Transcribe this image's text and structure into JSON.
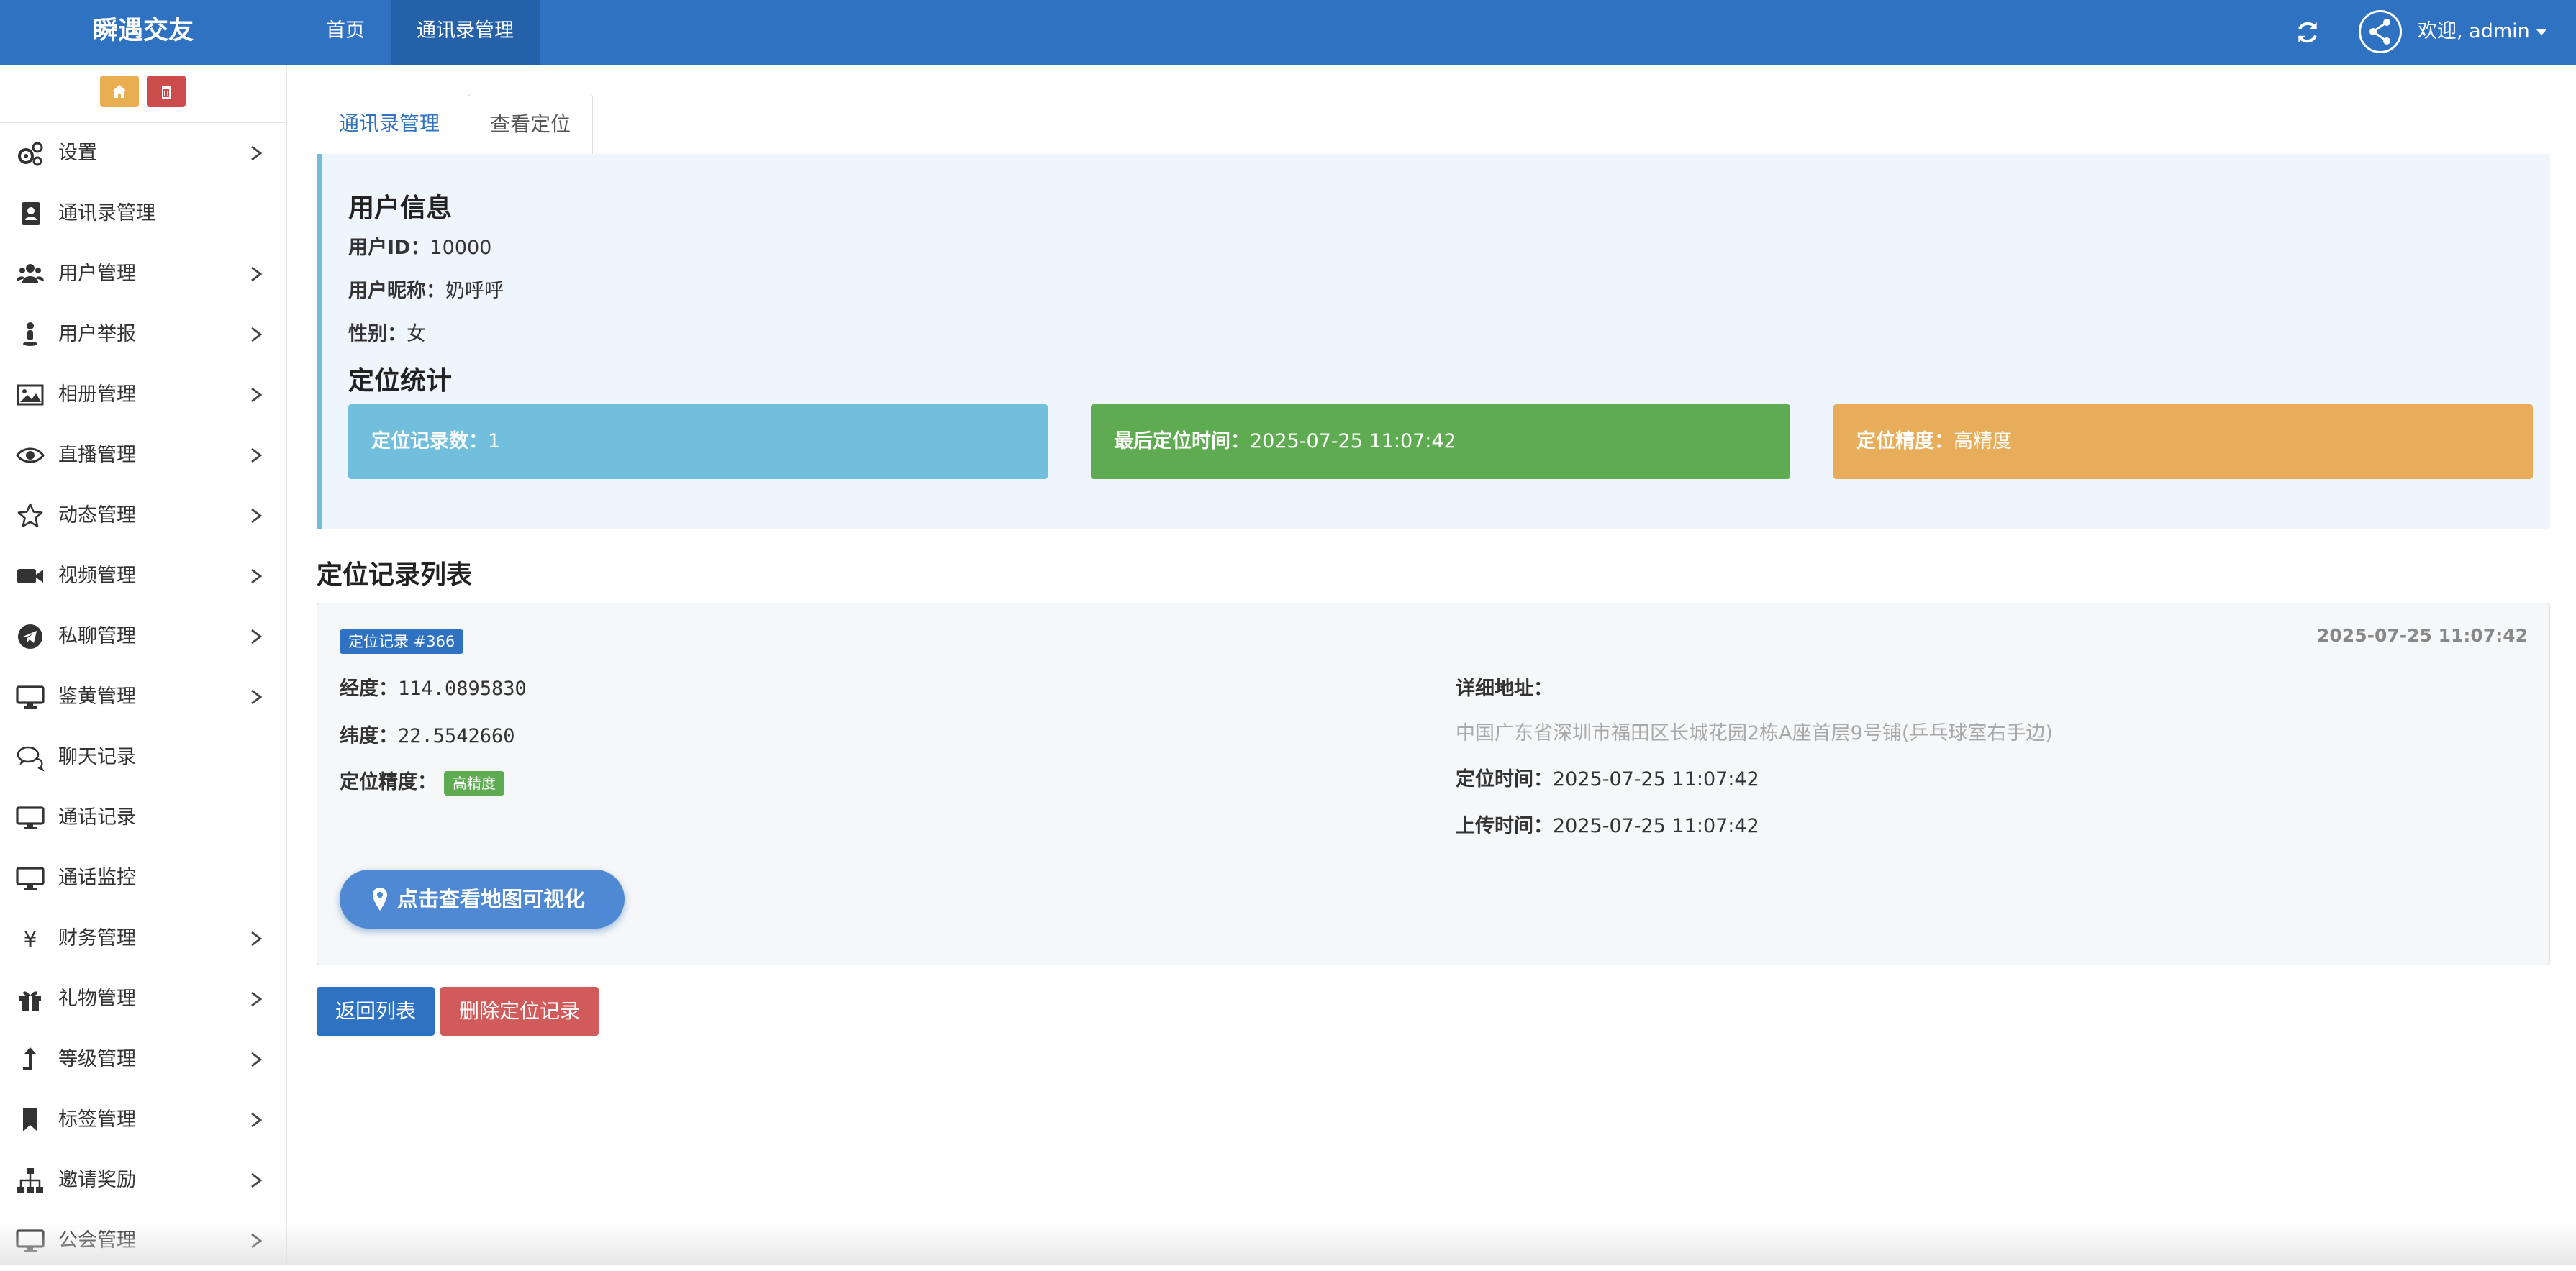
{
  "app": {
    "brand": "瞬遇交友",
    "nav": [
      "首页",
      "通讯录管理"
    ],
    "user_greeting": "欢迎, admin"
  },
  "sidebar": {
    "items": [
      {
        "label": "设置",
        "icon": "gears-icon",
        "expandable": true
      },
      {
        "label": "通讯录管理",
        "icon": "address-book-icon",
        "expandable": false
      },
      {
        "label": "用户管理",
        "icon": "users-icon",
        "expandable": true
      },
      {
        "label": "用户举报",
        "icon": "report-user-icon",
        "expandable": true
      },
      {
        "label": "相册管理",
        "icon": "image-icon",
        "expandable": true
      },
      {
        "label": "直播管理",
        "icon": "eye-icon",
        "expandable": true
      },
      {
        "label": "动态管理",
        "icon": "star-icon",
        "expandable": true
      },
      {
        "label": "视频管理",
        "icon": "video-camera-icon",
        "expandable": true
      },
      {
        "label": "私聊管理",
        "icon": "telegram-icon",
        "expandable": true
      },
      {
        "label": "鉴黄管理",
        "icon": "desktop-icon",
        "expandable": true
      },
      {
        "label": "聊天记录",
        "icon": "comments-icon",
        "expandable": false
      },
      {
        "label": "通话记录",
        "icon": "desktop-icon",
        "expandable": false
      },
      {
        "label": "通话监控",
        "icon": "desktop-icon",
        "expandable": false
      },
      {
        "label": "财务管理",
        "icon": "yen-icon",
        "expandable": true
      },
      {
        "label": "礼物管理",
        "icon": "gift-icon",
        "expandable": true
      },
      {
        "label": "等级管理",
        "icon": "level-up-icon",
        "expandable": true
      },
      {
        "label": "标签管理",
        "icon": "bookmark-icon",
        "expandable": true
      },
      {
        "label": "邀请奖励",
        "icon": "sitemap-icon",
        "expandable": true
      },
      {
        "label": "公会管理",
        "icon": "desktop-icon",
        "expandable": true
      }
    ]
  },
  "tabs": [
    "通讯录管理",
    "查看定位"
  ],
  "user_info": {
    "heading": "用户信息",
    "id_label": "用户ID：",
    "id_value": "10000",
    "nickname_label": "用户昵称：",
    "nickname_value": "奶呼呼",
    "gender_label": "性别：",
    "gender_value": "女"
  },
  "stats": {
    "heading": "定位统计",
    "count_label": "定位记录数：",
    "count_value": "1",
    "last_time_label": "最后定位时间：",
    "last_time_value": "2025-07-25 11:07:42",
    "accuracy_label": "定位精度：",
    "accuracy_value": "高精度"
  },
  "records": {
    "heading": "定位记录列表",
    "items": [
      {
        "badge": "定位记录 #366",
        "timestamp": "2025-07-25 11:07:42",
        "longitude_label": "经度：",
        "longitude": "114.0895830",
        "latitude_label": "纬度：",
        "latitude": "22.5542660",
        "accuracy_label": "定位精度：",
        "accuracy": "高精度",
        "address_label": "详细地址：",
        "address": "中国广东省深圳市福田区长城花园2栋A座首层9号铺(乒乓球室右手边)",
        "locate_time_label": "定位时间：",
        "locate_time": "2025-07-25 11:07:42",
        "upload_time_label": "上传时间：",
        "upload_time": "2025-07-25 11:07:42",
        "map_button": "点击查看地图可视化"
      }
    ]
  },
  "actions": {
    "back": "返回列表",
    "delete": "删除定位记录"
  },
  "colors": {
    "primary": "#2f72c1",
    "info": "#72bfdd",
    "success": "#5fab51",
    "warning": "#e8ad5a",
    "danger": "#d15b5b"
  }
}
